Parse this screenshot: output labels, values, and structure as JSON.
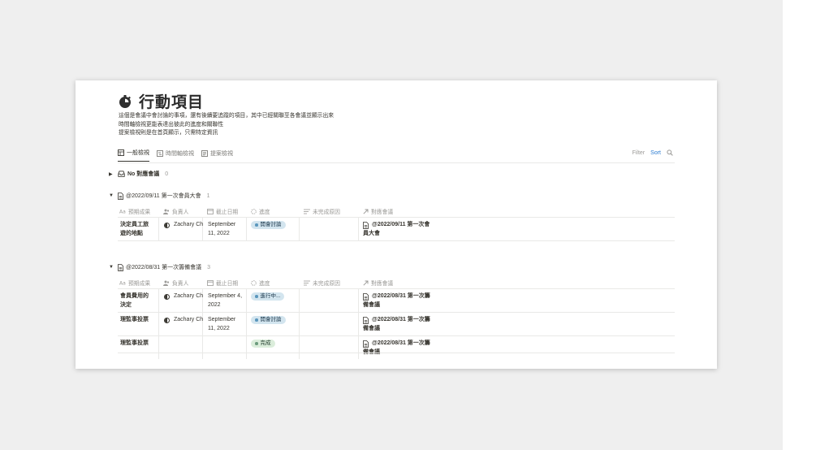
{
  "page": {
    "title": "行動項目",
    "description": [
      "這個是會議中會討論的事項，還有後續要追蹤的項目，其中已經關聯至各會議並顯示出來",
      "時間軸檢視更能表達出彼此的進度和關聯性",
      "提案檢視則是在首頁顯示，只需特定資訊"
    ]
  },
  "tabs": [
    {
      "label": "一般檢視",
      "icon": "table-icon",
      "active": true
    },
    {
      "label": "時間軸檢視",
      "icon": "timeline-icon",
      "active": false
    },
    {
      "label": "提案檢視",
      "icon": "list-icon",
      "active": false
    }
  ],
  "toolbar": {
    "filter": "Filter",
    "sort": "Sort",
    "search_icon": "search-icon"
  },
  "columns": [
    "預期成果",
    "負責人",
    "截止日期",
    "進度",
    "未完成原因",
    "對應會議"
  ],
  "colors": {
    "accent": "#2e7dd2",
    "blue_tag_bg": "#d3e5ef",
    "green_tag_bg": "#dbeddb"
  },
  "groups": [
    {
      "name": "No 對應會議",
      "count": "0",
      "collapsed": true,
      "icon": "inbox-icon"
    },
    {
      "name": "@2022/09/11 第一次會員大會",
      "count": "1",
      "collapsed": false,
      "icon": "page-icon",
      "rows": [
        {
          "result": [
            "決定員工旅",
            "遊的地點"
          ],
          "owner": "Zachary Ch",
          "due": [
            "September",
            "11, 2022"
          ],
          "status": "開會討論",
          "status_color": "blue",
          "reason": "",
          "meeting": [
            "@2022/09/11 第一次會",
            "員大會"
          ]
        }
      ]
    },
    {
      "name": "@2022/08/31 第一次籌備會議",
      "count": "3",
      "collapsed": false,
      "icon": "page-icon",
      "rows": [
        {
          "result": [
            "會員費用的",
            "決定"
          ],
          "owner": "Zachary Ch",
          "due": [
            "September 4,",
            "2022"
          ],
          "status": "進行中...",
          "status_color": "blue",
          "reason": "",
          "meeting": [
            "@2022/08/31 第一次籌",
            "備會議"
          ]
        },
        {
          "result": [
            "理監事投票",
            ""
          ],
          "owner": "Zachary Ch",
          "due": [
            "September",
            "11, 2022"
          ],
          "status": "開會討論",
          "status_color": "blue",
          "reason": "",
          "meeting": [
            "@2022/08/31 第一次籌",
            "備會議"
          ]
        },
        {
          "result": [
            "理監事投票",
            ""
          ],
          "owner": "",
          "due": [
            "",
            ""
          ],
          "status": "完成",
          "status_color": "green",
          "reason": "",
          "meeting": [
            "@2022/08/31 第一次籌",
            "備會議"
          ]
        }
      ]
    }
  ]
}
